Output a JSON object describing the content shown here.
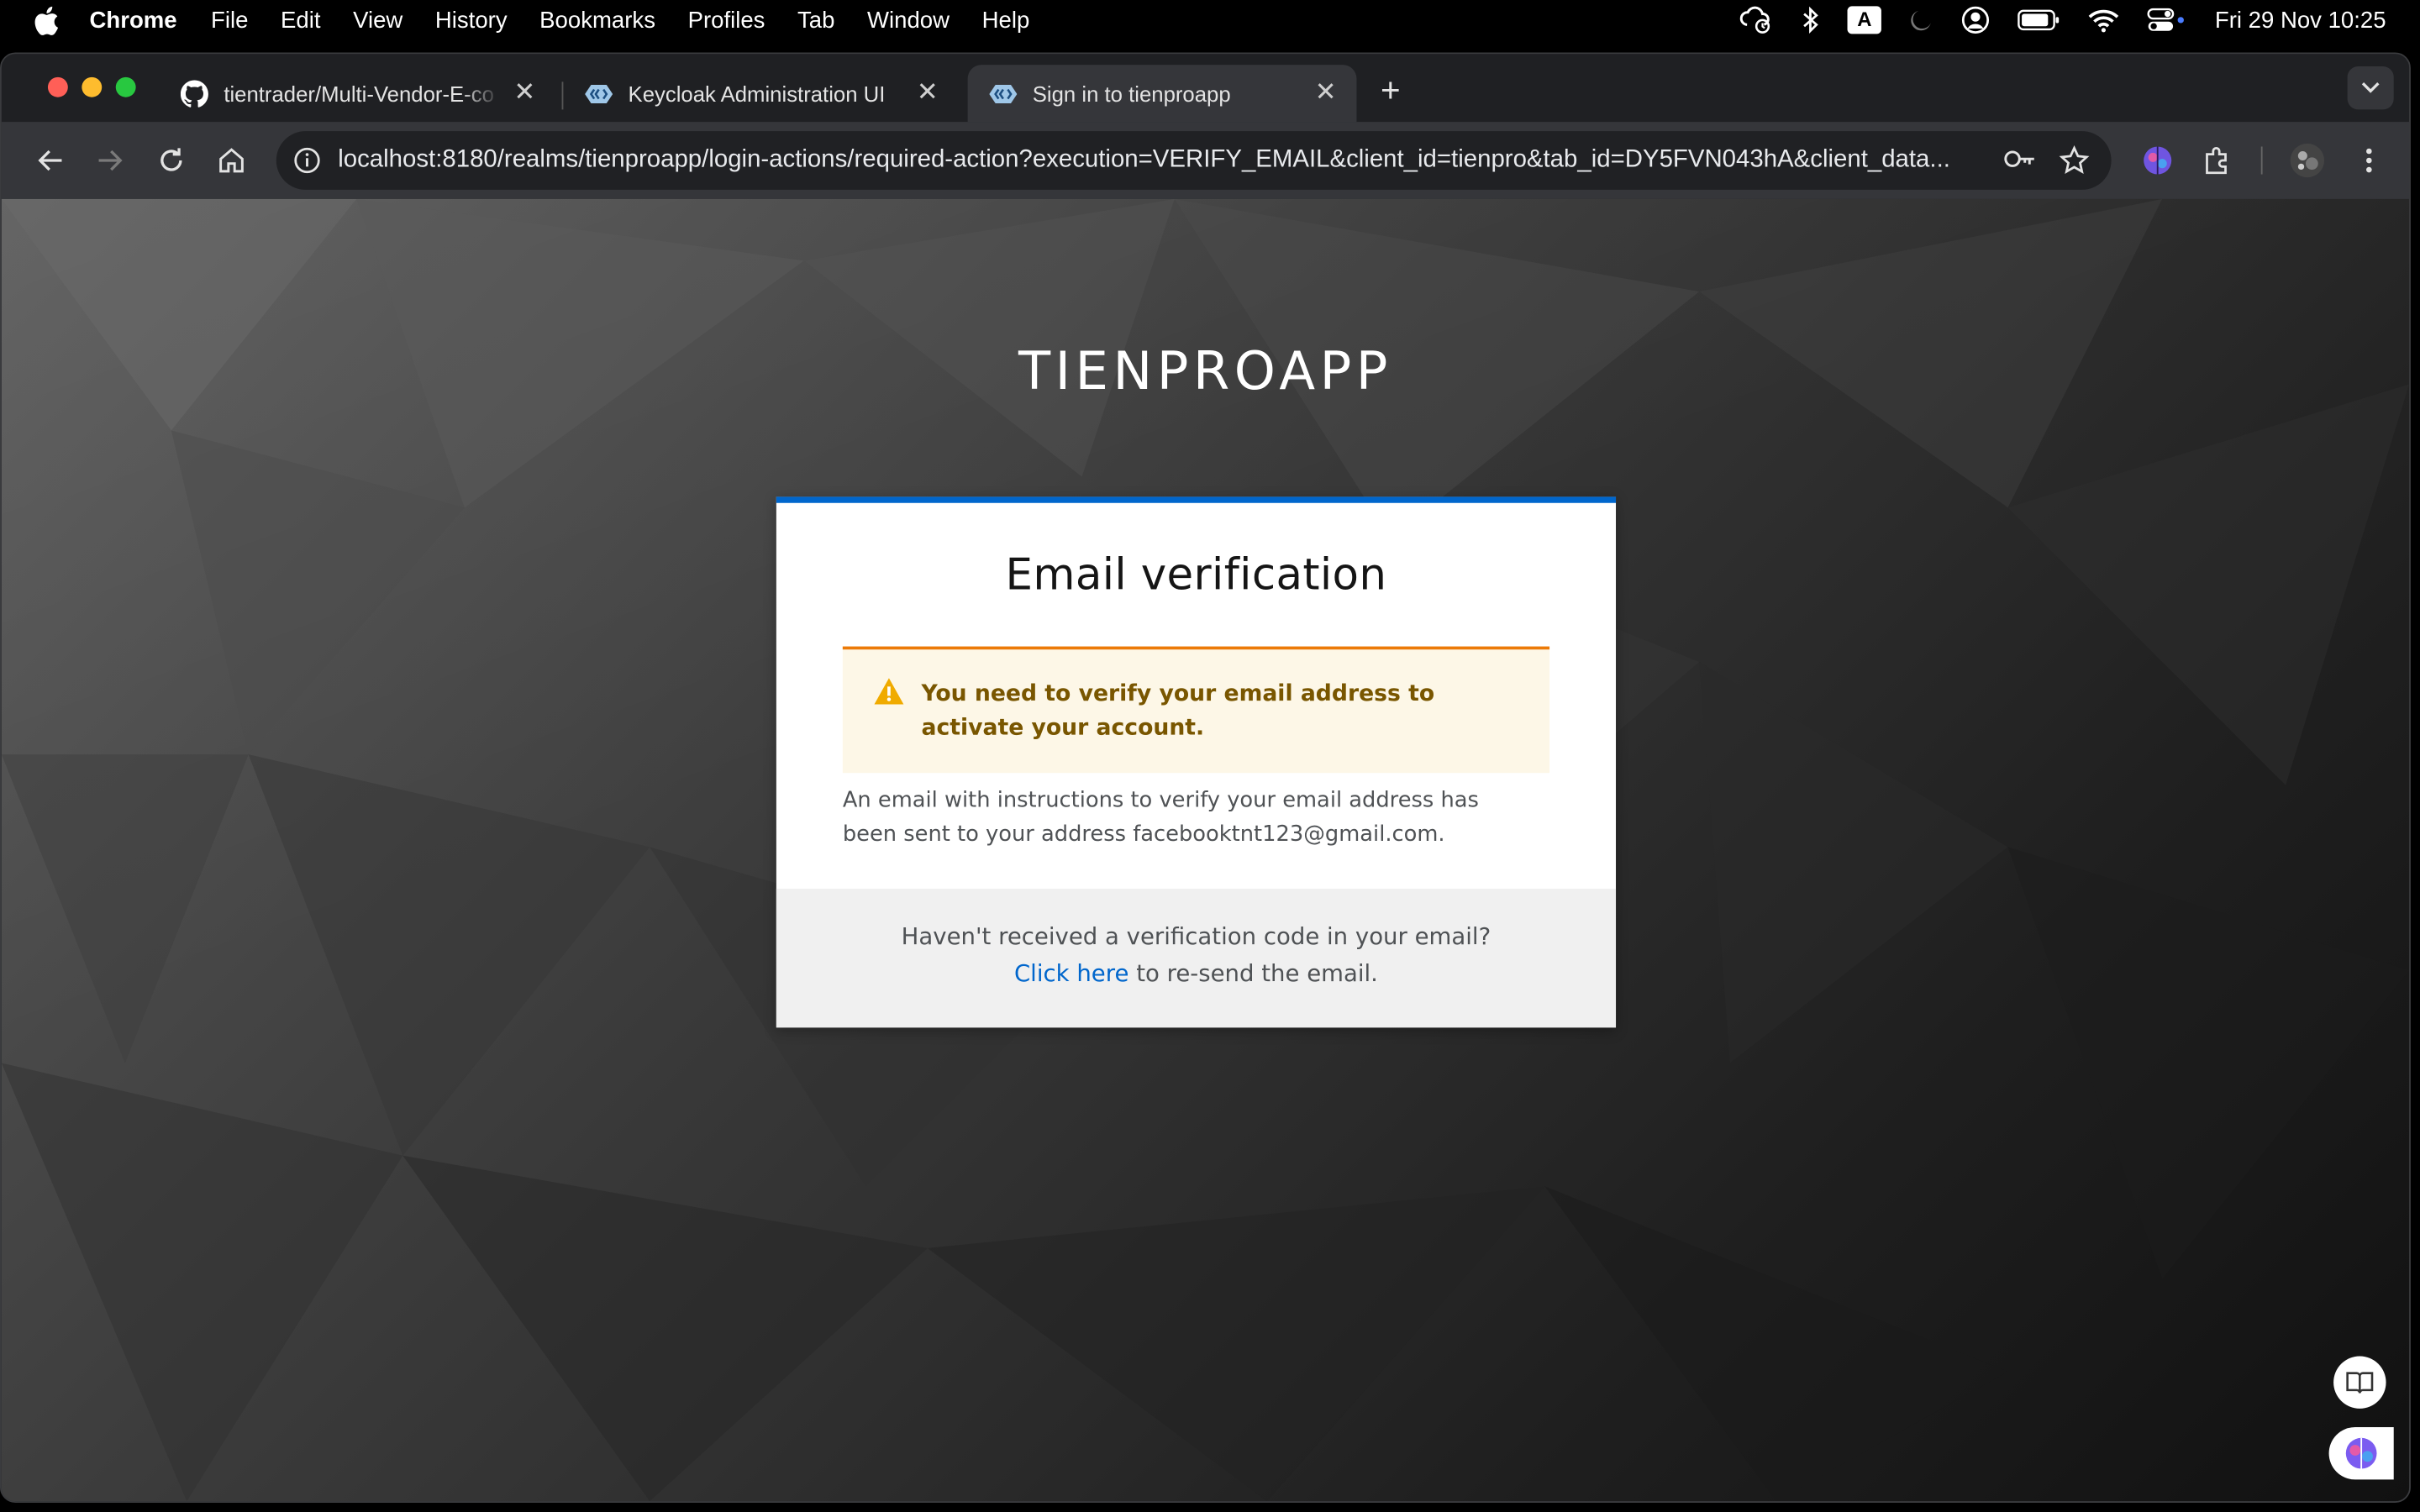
{
  "menubar": {
    "app_name": "Chrome",
    "items": [
      "File",
      "Edit",
      "View",
      "History",
      "Bookmarks",
      "Profiles",
      "Tab",
      "Window",
      "Help"
    ],
    "input_badge": "A",
    "clock": "Fri 29 Nov  10:25"
  },
  "tabs": [
    {
      "title": "tientrader/Multi-Vendor-E-co",
      "icon": "github-icon"
    },
    {
      "title": "Keycloak Administration UI",
      "icon": "keycloak-icon"
    },
    {
      "title": "Sign in to tienproapp",
      "icon": "keycloak-icon",
      "active": true
    }
  ],
  "toolbar": {
    "url": "localhost:8180/realms/tienproapp/login-actions/required-action?execution=VERIFY_EMAIL&client_id=tienpro&tab_id=DY5FVN043hA&client_data..."
  },
  "page": {
    "realm_title": "TIENPROAPP",
    "card_title": "Email verification",
    "alert_text": "You need to verify your email address to activate your account.",
    "instructions": "An email with instructions to verify your email address has been sent to your address facebooktnt123@gmail.com.",
    "footer_question": "Haven't received a verification code in your email?",
    "resend_link": "Click here",
    "resend_suffix": " to re-send the email."
  },
  "colors": {
    "accent": "#0066cc",
    "warning_border": "#ec7a08",
    "warning_bg": "#fdf7e7",
    "warning_text": "#795600"
  }
}
